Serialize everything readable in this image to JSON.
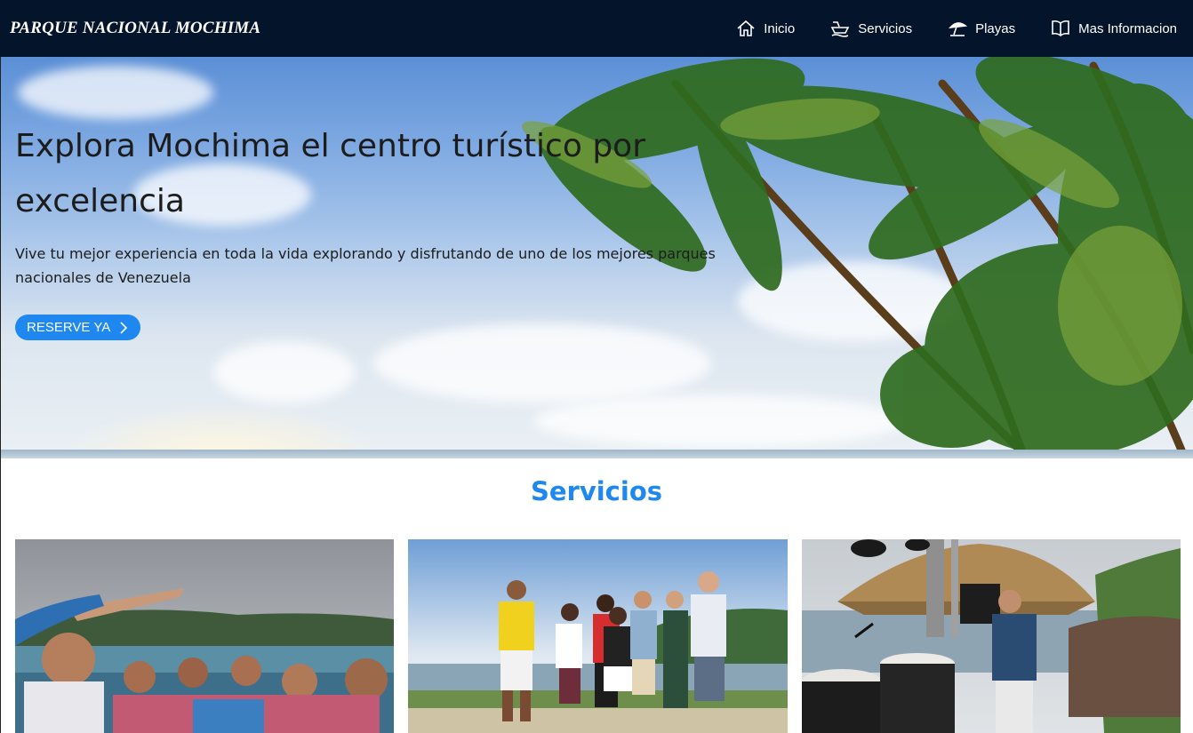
{
  "brand": "PARQUE NACIONAL MOCHIMA",
  "nav": {
    "items": [
      {
        "label": "Inicio",
        "icon": "home-icon"
      },
      {
        "label": "Servicios",
        "icon": "boat-icon"
      },
      {
        "label": "Playas",
        "icon": "beach-umbrella-icon"
      },
      {
        "label": "Mas Informacion",
        "icon": "book-icon"
      }
    ]
  },
  "hero": {
    "title": "Explora Mochima el centro turístico por excelencia",
    "text": "Vive tu mejor experiencia en toda la vida explorando y disfrutando de uno de los mejores parques nacionales de Venezuela",
    "button": "RESERVE YA"
  },
  "services": {
    "title": "Servicios",
    "cards": [
      {
        "image": "group-selfie-boat-photo"
      },
      {
        "image": "tour-guide-group-photo"
      },
      {
        "image": "musician-drums-beach-photo"
      }
    ]
  },
  "colors": {
    "navbar": "#04142a",
    "accent": "#1e88f0",
    "text": "#1c1c1c"
  }
}
